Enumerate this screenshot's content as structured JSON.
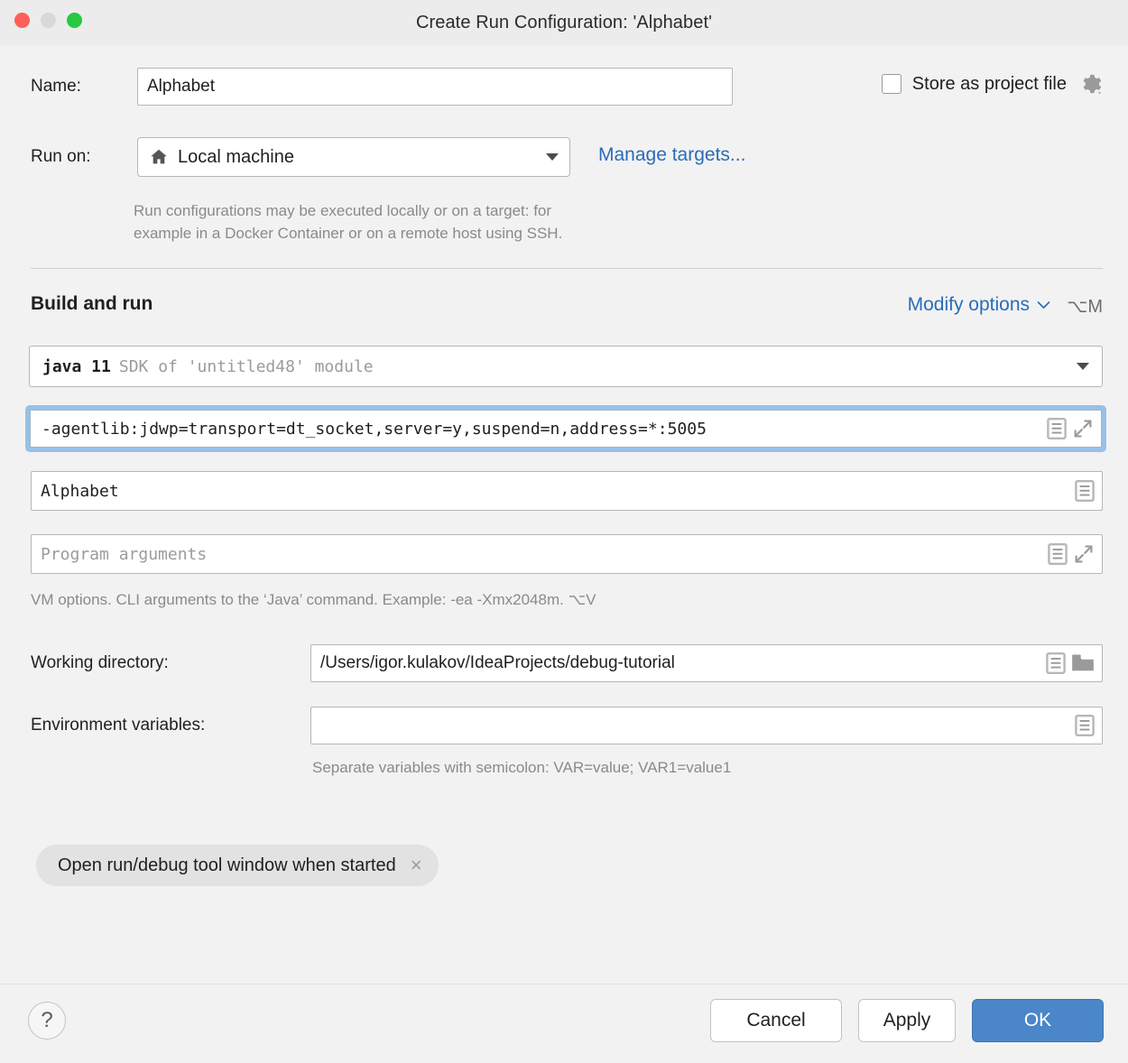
{
  "window": {
    "title": "Create Run Configuration: 'Alphabet'",
    "traffic_lights": [
      "close-button",
      "minimize-button",
      "zoom-button"
    ]
  },
  "form": {
    "name_label": "Name:",
    "name_value": "Alphabet",
    "store_as_project_file_label": "Store as project file",
    "store_as_project_file_checked": false,
    "run_on_label": "Run on:",
    "run_on_value": "Local machine",
    "run_on_icon": "home-icon",
    "manage_targets_label": "Manage targets...",
    "run_on_hint": "Run configurations may be executed locally or on a target: for\nexample in a Docker Container or on a remote host using SSH."
  },
  "build_and_run": {
    "section_title": "Build and run",
    "modify_options_label": "Modify options",
    "modify_options_shortcut": "⌥M",
    "sdk_main": "java 11",
    "sdk_sub": "SDK of 'untitled48' module",
    "vm_options_value": "-agentlib:jdwp=transport=dt_socket,server=y,suspend=n,address=*:5005",
    "main_class_value": "Alphabet",
    "program_arguments_placeholder": "Program arguments",
    "program_arguments_value": "",
    "vm_options_hint": "VM options. CLI arguments to the ‘Java’ command. Example: -ea -Xmx2048m. ⌥V"
  },
  "paths": {
    "working_directory_label": "Working directory:",
    "working_directory_value": "/Users/igor.kulakov/IdeaProjects/debug-tutorial",
    "environment_variables_label": "Environment variables:",
    "environment_variables_value": "",
    "environment_variables_hint": "Separate variables with semicolon: VAR=value; VAR1=value1"
  },
  "options_chip": {
    "label": "Open run/debug tool window when started",
    "close_glyph": "×"
  },
  "footer": {
    "help_glyph": "?",
    "cancel_label": "Cancel",
    "apply_label": "Apply",
    "ok_label": "OK"
  },
  "colors": {
    "window_background": "#f2f2f2",
    "titlebar_background": "#ececec",
    "link_blue": "#2b6cb8",
    "primary_button": "#4a86c8",
    "focus_ring": "#97c1e8",
    "traffic_red": "#ff5f57",
    "traffic_yellow": "#d8d8d8",
    "traffic_green": "#28c840",
    "hint_text": "#8a8a8a",
    "placeholder_text": "#9b9b9b",
    "chip_background": "#e2e2e2"
  }
}
